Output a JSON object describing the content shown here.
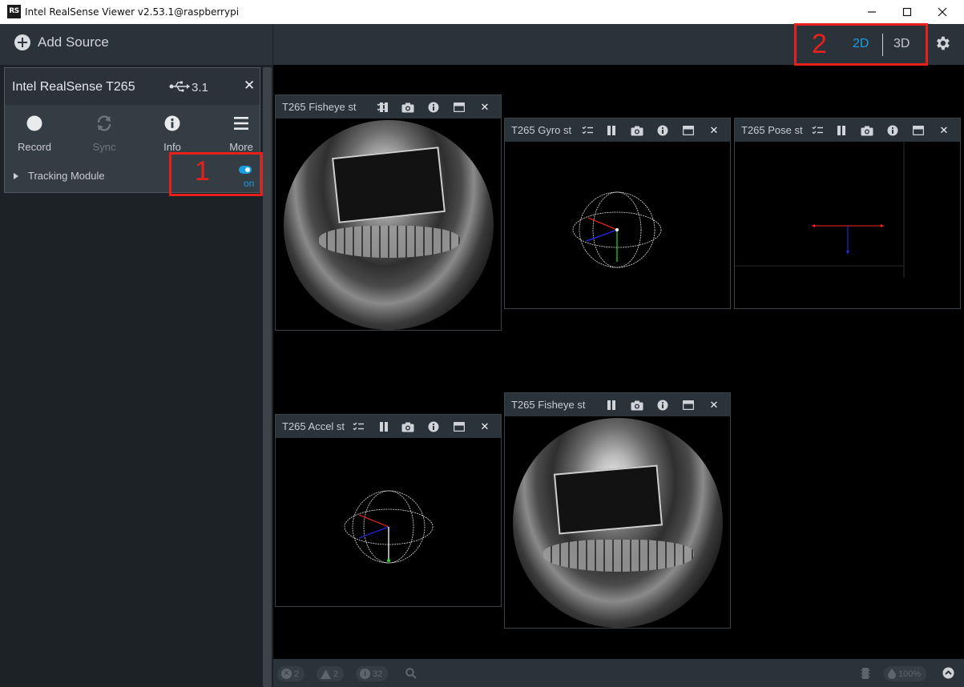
{
  "window": {
    "logo": "RS",
    "title": "Intel RealSense Viewer v2.53.1@raspberrypi"
  },
  "toolbar": {
    "add_source": "Add Source",
    "view_2d": "2D",
    "view_3d": "3D"
  },
  "annotations": {
    "marker_1": "1",
    "marker_2": "2",
    "color": "#e8201c"
  },
  "device": {
    "name": "Intel RealSense T265",
    "usb_version": "3.1",
    "buttons": [
      {
        "label": "Record",
        "icon": "record-icon"
      },
      {
        "label": "Sync",
        "icon": "sync-icon"
      },
      {
        "label": "Info",
        "icon": "info-icon"
      },
      {
        "label": "More",
        "icon": "menu-icon"
      }
    ],
    "module": {
      "label": "Tracking Module",
      "toggle_state": "on"
    }
  },
  "streams": [
    {
      "title": "T265 Fisheye st",
      "type": "fisheye"
    },
    {
      "title": "T265 Gyro st",
      "type": "motion"
    },
    {
      "title": "T265 Pose st",
      "type": "pose"
    },
    {
      "title": "T265 Accel st",
      "type": "motion"
    },
    {
      "title": "T265 Fisheye st",
      "type": "fisheye"
    }
  ],
  "statusbar": {
    "errors": "2",
    "warnings": "2",
    "info": "32",
    "cpu": "100%"
  },
  "colors": {
    "accent": "#1a9ee0",
    "panel": "#2b333a",
    "background": "#000000"
  }
}
